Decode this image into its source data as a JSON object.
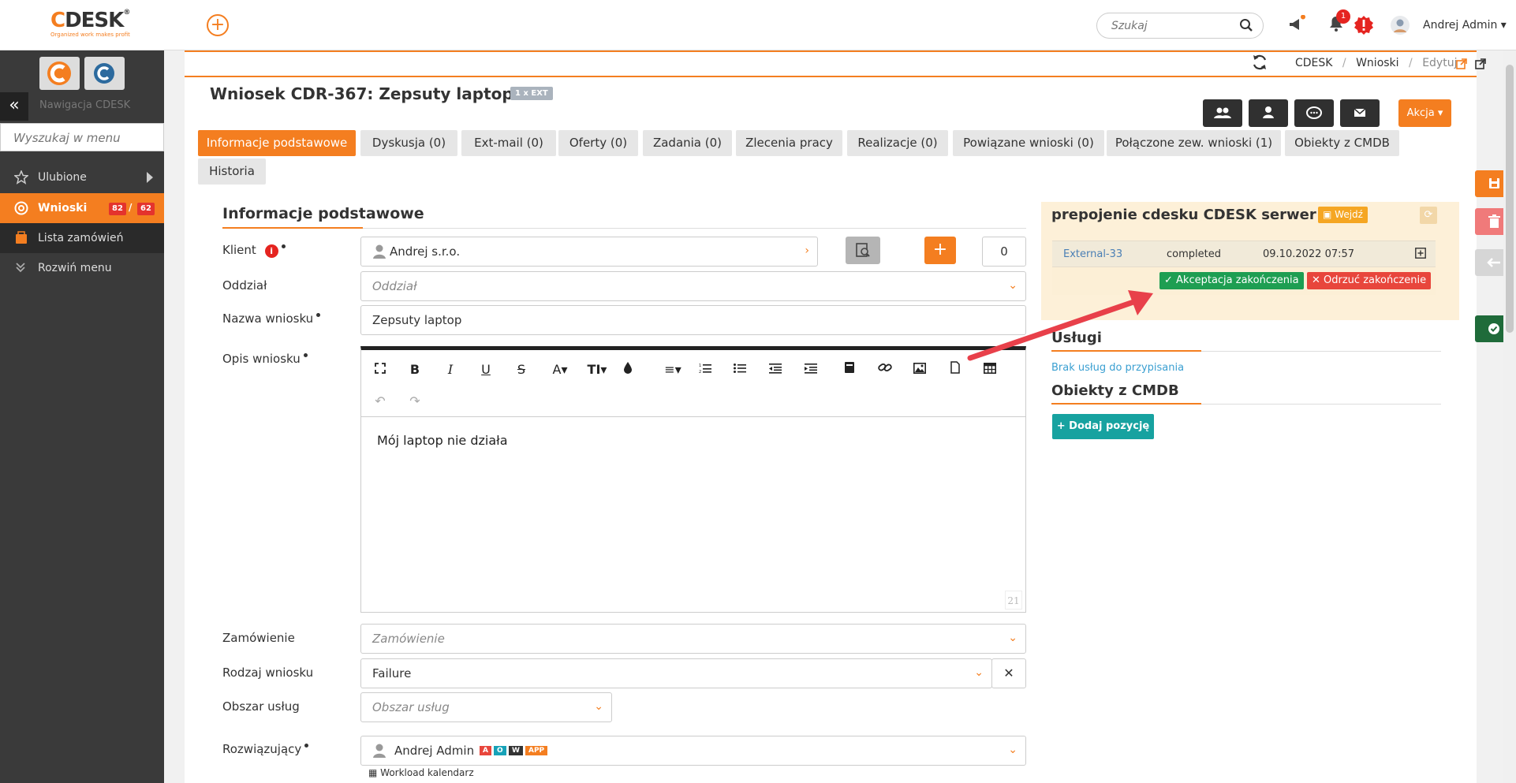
{
  "app": {
    "logo_text": "DESK",
    "logo_c": "C",
    "logo_tagline": "Organized work makes profit"
  },
  "header": {
    "search_placeholder": "Szukaj",
    "notification_count": "1",
    "user_name": "Andrej Admin ▾"
  },
  "sidebar": {
    "nav_title": "Nawigacja CDESK",
    "search_placeholder": "Wyszukaj w menu",
    "items": [
      {
        "label": "Ulubione"
      },
      {
        "label": "Wnioski",
        "count_a": "82",
        "count_sep": "/",
        "count_b": "62"
      },
      {
        "label": "Lista zamówień"
      },
      {
        "label": "Rozwiń menu"
      }
    ]
  },
  "breadcrumb": [
    "CDESK",
    "/",
    "Wnioski",
    "/",
    "Edytuj"
  ],
  "page": {
    "title": "Wniosek CDR-367: Zepsuty laptop",
    "ext_badge": "1 x EXT",
    "action_label": "Akcja ▾"
  },
  "tabs": [
    "Informacje podstawowe",
    "Dyskusja (0)",
    "Ext-mail (0)",
    "Oferty (0)",
    "Zadania (0)",
    "Zlecenia pracy",
    "Realizacje (0)",
    "Powiązane wnioski (0)",
    "Połączone zew. wnioski (1)",
    "Obiekty z CMDB",
    "Historia"
  ],
  "form": {
    "section_title": "Informacje podstawowe",
    "client_label": "Klient",
    "client_value": "Andrej s.r.o.",
    "client_counter": "0",
    "branch_label": "Oddział",
    "branch_placeholder": "Oddział",
    "name_label": "Nazwa wniosku",
    "name_value": "Zepsuty laptop",
    "desc_label": "Opis wniosku",
    "desc_value": "Mój laptop nie działa",
    "desc_char_count": "21",
    "order_label": "Zamówienie",
    "order_placeholder": "Zamówienie",
    "type_label": "Rodzaj wniosku",
    "type_value": "Failure",
    "area_label": "Obszar usług",
    "area_placeholder": "Obszar usług",
    "solver_label": "Rozwiązujący",
    "solver_value": "Andrej Admin",
    "solver_tags": [
      "A",
      "O",
      "W",
      "APP"
    ],
    "workload_link": "Workload kalendarz"
  },
  "external": {
    "title": "prepojenie cdesku CDESK serwer",
    "enter_label": "Wejdź",
    "row": {
      "id": "External-33",
      "status": "completed",
      "date": "09.10.2022 07:57"
    },
    "accept_label": "Akceptacja zakończenia",
    "reject_label": "Odrzuć zakończenie"
  },
  "services": {
    "title": "Usługi",
    "empty_text": "Brak usług do przypisania"
  },
  "cmdb": {
    "title": "Obiekty z CMDB",
    "add_label": "+ Dodaj pozycję"
  },
  "colors": {
    "accent": "#f47e20",
    "sidebar_bg": "#3a3a3a",
    "green": "#1e9e52",
    "red": "#e8463c",
    "teal": "#17a2a0"
  }
}
